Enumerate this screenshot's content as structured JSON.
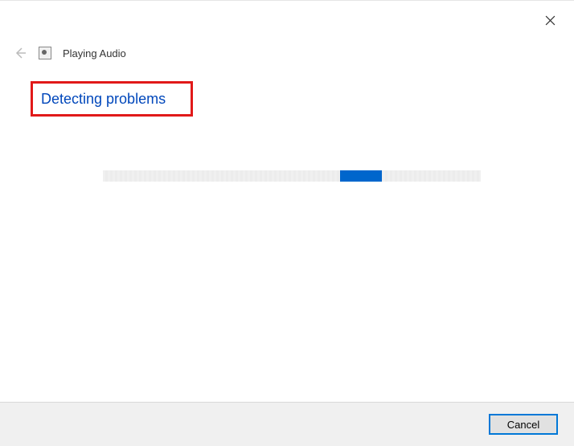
{
  "header": {
    "title": "Playing Audio"
  },
  "main": {
    "status_heading": "Detecting problems"
  },
  "footer": {
    "cancel_label": "Cancel"
  }
}
